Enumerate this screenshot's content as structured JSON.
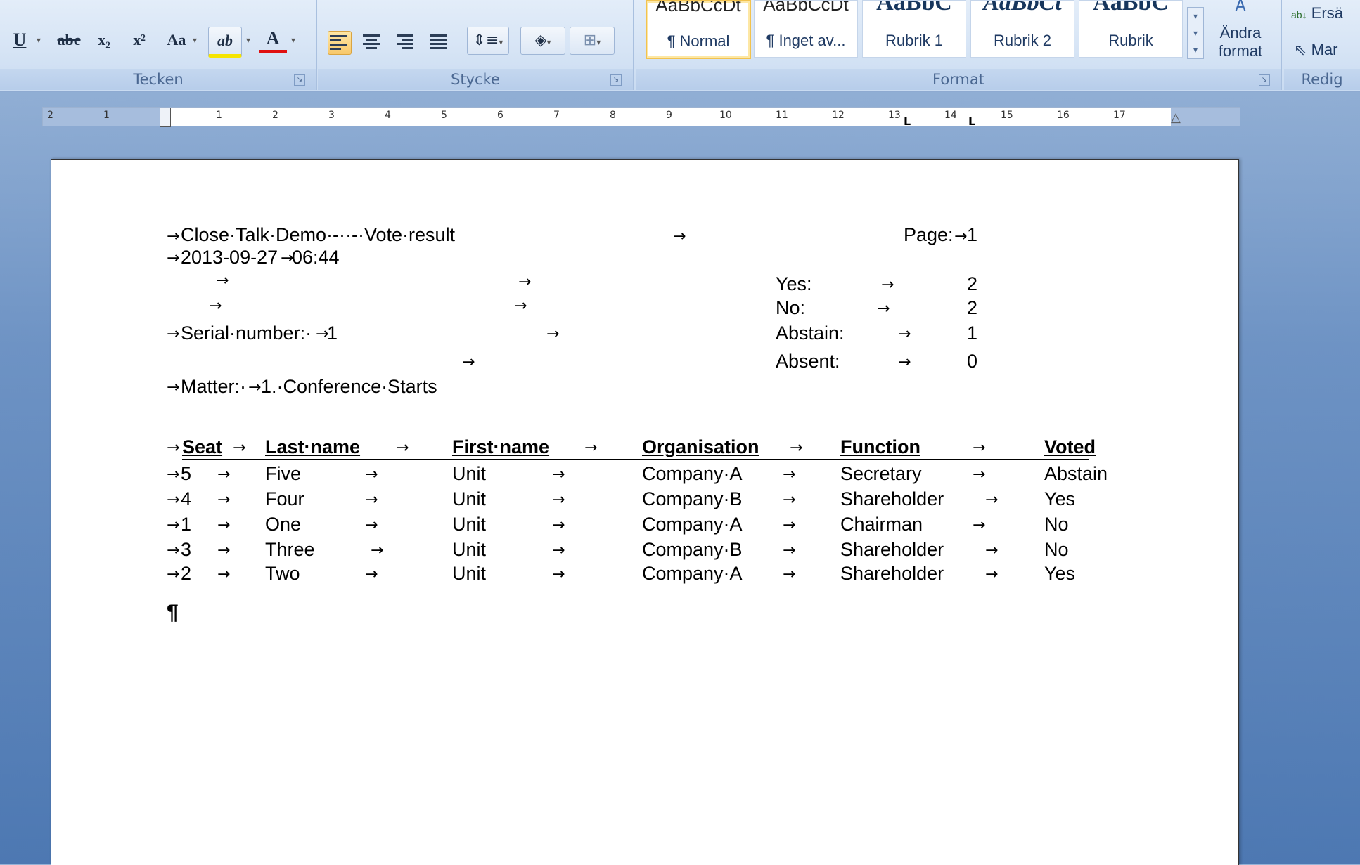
{
  "ribbon": {
    "font_group": {
      "label": "Tecken",
      "buttons": [
        {
          "label": "U",
          "name": "underline"
        },
        {
          "label": "abc",
          "name": "strikethrough"
        },
        {
          "label": "x₂",
          "name": "subscript"
        },
        {
          "label": "x²",
          "name": "superscript"
        },
        {
          "label": "Aa",
          "name": "change-case"
        },
        {
          "label": "ab",
          "name": "highlight"
        },
        {
          "label": "A",
          "name": "font-color"
        }
      ]
    },
    "paragraph_group": {
      "label": "Stycke"
    },
    "styles_group": {
      "label": "Format",
      "tiles": [
        {
          "sample": "AaBbCcDt",
          "caption": "¶ Normal"
        },
        {
          "sample": "AaBbCcDt",
          "caption": "¶ Inget av..."
        },
        {
          "sample": "AaBbC",
          "caption": "Rubrik 1"
        },
        {
          "sample": "AaBbCt",
          "caption": "Rubrik 2"
        },
        {
          "sample": "AaBbC",
          "caption": "Rubrik"
        }
      ],
      "change_styles": "Ändra format"
    },
    "editing_group": {
      "label": "Redig",
      "replace": "Ersä",
      "select": "Mar"
    }
  },
  "ruler": {
    "numbers": [
      "2",
      "1",
      "1",
      "2",
      "3",
      "4",
      "5",
      "6",
      "7",
      "8",
      "9",
      "10",
      "11",
      "12",
      "13",
      "14",
      "15",
      "16",
      "17"
    ]
  },
  "document": {
    "title": "Close·Talk·Demo·-··-·Vote·result",
    "page_label": "Page:",
    "page_number": "1",
    "datetime_date": "2013-09-27",
    "datetime_time": "06:44",
    "serial_label": "Serial·number:·",
    "serial_value": "1",
    "matter_label": "Matter:·",
    "matter_value": "1.·Conference·Starts",
    "tally": [
      {
        "label": "Yes:",
        "value": "2"
      },
      {
        "label": "No:",
        "value": "2"
      },
      {
        "label": "Abstain:",
        "value": "1"
      },
      {
        "label": "Absent:",
        "value": "0"
      }
    ],
    "table": {
      "headers": [
        "Seat",
        "Last·name",
        "First·name",
        "Organisation",
        "Function",
        "Voted"
      ],
      "rows": [
        [
          "5",
          "Five",
          "Unit",
          "Company·A",
          "Secretary",
          "Abstain"
        ],
        [
          "4",
          "Four",
          "Unit",
          "Company·B",
          "Shareholder",
          "Yes"
        ],
        [
          "1",
          "One",
          "Unit",
          "Company·A",
          "Chairman",
          "No"
        ],
        [
          "3",
          "Three",
          "Unit",
          "Company·B",
          "Shareholder",
          "No"
        ],
        [
          "2",
          "Two",
          "Unit",
          "Company·A",
          "Shareholder",
          "Yes"
        ]
      ]
    },
    "pilcrow": "¶"
  }
}
